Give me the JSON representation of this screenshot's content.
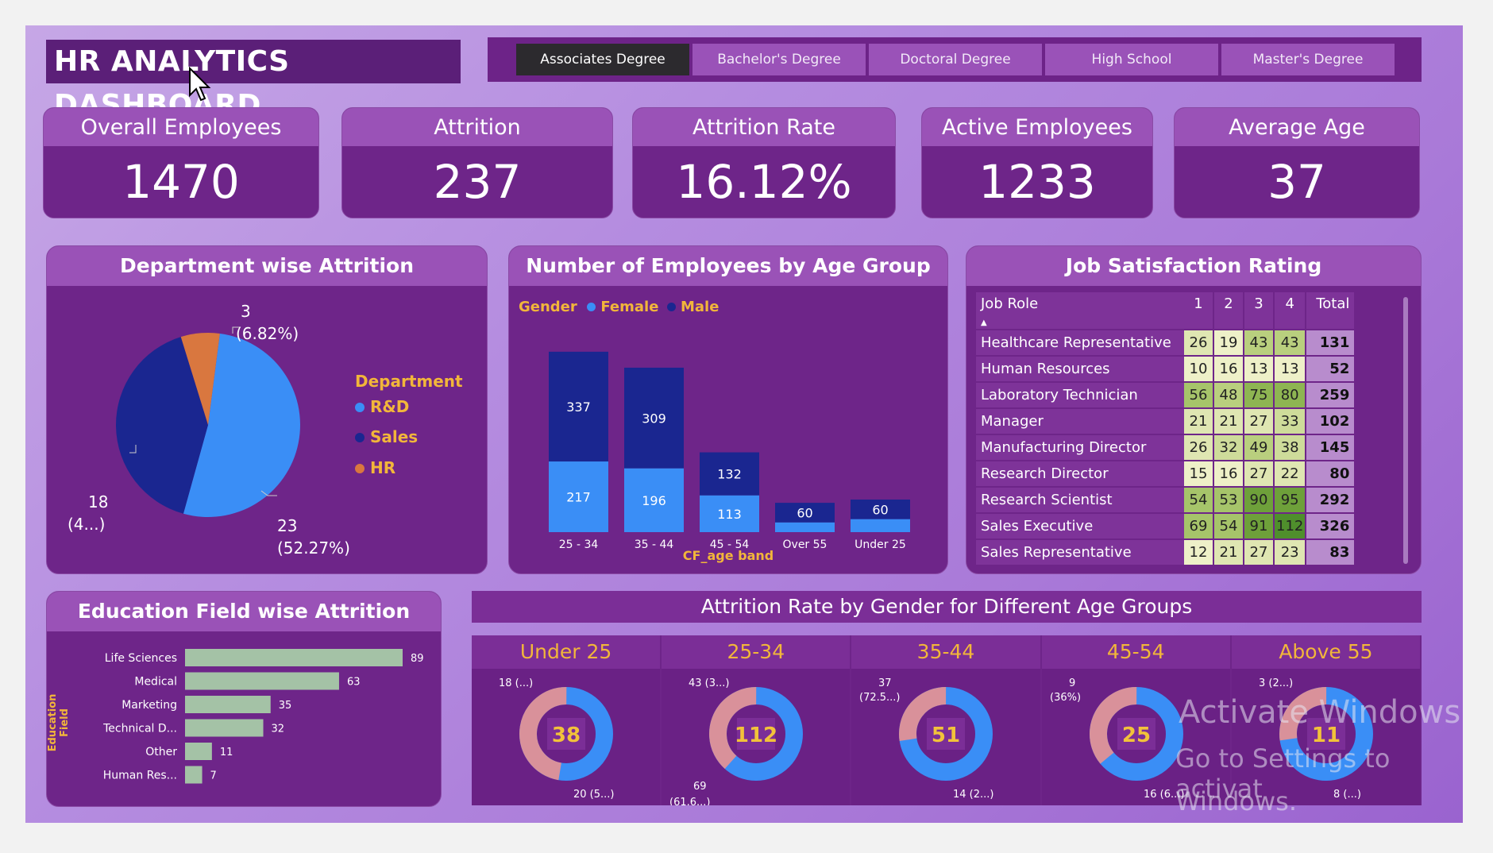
{
  "title": "HR ANALYTICS DASHBOARD",
  "slicer": {
    "options": [
      "Associates Degree",
      "Bachelor's Degree",
      "Doctoral Degree",
      "High School",
      "Master's Degree"
    ],
    "selected": "Associates Degree"
  },
  "kpis": [
    {
      "label": "Overall Employees",
      "value": "1470"
    },
    {
      "label": "Attrition",
      "value": "237"
    },
    {
      "label": "Attrition Rate",
      "value": "16.12%"
    },
    {
      "label": "Active Employees",
      "value": "1233"
    },
    {
      "label": "Average Age",
      "value": "37"
    }
  ],
  "dept": {
    "title": "Department wise Attrition",
    "legend_title": "Department",
    "labels": {
      "hr": {
        "v": "3",
        "p": "(6.82%)"
      },
      "sales": {
        "v": "18",
        "p": "(4...)"
      },
      "rd": {
        "v": "23",
        "p": "(52.27%)"
      }
    }
  },
  "age_group": {
    "title": "Number of Employees by Age Group",
    "legend_title": "Gender",
    "xlabel": "CF_age band"
  },
  "job_sat": {
    "title": "Job Satisfaction Rating",
    "headers": [
      "Job Role",
      "1",
      "2",
      "3",
      "4",
      "Total"
    ],
    "rows": [
      [
        "Healthcare Representative",
        "26",
        "19",
        "43",
        "43",
        "131"
      ],
      [
        "Human Resources",
        "10",
        "16",
        "13",
        "13",
        "52"
      ],
      [
        "Laboratory Technician",
        "56",
        "48",
        "75",
        "80",
        "259"
      ],
      [
        "Manager",
        "21",
        "21",
        "27",
        "33",
        "102"
      ],
      [
        "Manufacturing Director",
        "26",
        "32",
        "49",
        "38",
        "145"
      ],
      [
        "Research Director",
        "15",
        "16",
        "27",
        "22",
        "80"
      ],
      [
        "Research Scientist",
        "54",
        "53",
        "90",
        "95",
        "292"
      ],
      [
        "Sales Executive",
        "69",
        "54",
        "91",
        "112",
        "326"
      ],
      [
        "Sales Representative",
        "12",
        "21",
        "27",
        "23",
        "83"
      ]
    ]
  },
  "edu": {
    "title": "Education Field wise Attrition",
    "ylabel": "Education Field"
  },
  "gender_age": {
    "title": "Attrition Rate by Gender for Different Age Groups",
    "groups": [
      {
        "name": "Under 25",
        "center": "38",
        "top": "18 (...)",
        "top2": "",
        "bottom": "20 (5...)",
        "bottom2": ""
      },
      {
        "name": "25-34",
        "center": "112",
        "top": "43 (3...)",
        "top2": "",
        "bottom": "69",
        "bottom2": "(61.6...)"
      },
      {
        "name": "35-44",
        "center": "51",
        "top": "37",
        "top2": "(72.5...)",
        "bottom": "14 (2...)",
        "bottom2": ""
      },
      {
        "name": "45-54",
        "center": "25",
        "top": "9",
        "top2": "(36%)",
        "bottom": "16 (6...)",
        "bottom2": ""
      },
      {
        "name": "Above 55",
        "center": "11",
        "top": "3 (2...)",
        "top2": "",
        "bottom": "8 (...)",
        "bottom2": ""
      }
    ]
  },
  "watermark": {
    "line1": "Activate Windows",
    "line2": "Go to Settings to activat",
    "line3": "Windows."
  },
  "colors": {
    "female": "#3a8ef6",
    "male": "#1a2690",
    "hr": "#d9773f",
    "bar": "#a4c2a6",
    "donut_female": "#3a8ef6",
    "donut_male": "#d9919a"
  },
  "chart_data": [
    {
      "type": "pie",
      "title": "Department wise Attrition",
      "categories": [
        "R&D",
        "Sales",
        "HR"
      ],
      "values": [
        23,
        18,
        3
      ],
      "legend": "right"
    },
    {
      "type": "bar",
      "title": "Number of Employees by Age Group",
      "categories": [
        "25 - 34",
        "35 - 44",
        "45 - 54",
        "Over 55",
        "Under 25"
      ],
      "series": [
        {
          "name": "Female",
          "values": [
            217,
            196,
            113,
            30,
            40
          ]
        },
        {
          "name": "Male",
          "values": [
            337,
            309,
            132,
            60,
            60
          ]
        }
      ],
      "xlabel": "CF_age band",
      "stacked": true,
      "legend": "top-left"
    },
    {
      "type": "bar",
      "title": "Education Field wise Attrition",
      "categories": [
        "Life Sciences",
        "Medical",
        "Marketing",
        "Technical D...",
        "Other",
        "Human Res..."
      ],
      "values": [
        89,
        63,
        35,
        32,
        11,
        7
      ],
      "ylabel": "Education Field",
      "orientation": "horizontal"
    },
    {
      "type": "pie",
      "title": "Attrition Rate by Gender for Different Age Groups",
      "categories": [
        "Under 25",
        "25-34",
        "35-44",
        "45-54",
        "Above 55"
      ],
      "series": [
        {
          "name": "Female",
          "values": [
            20,
            69,
            37,
            16,
            8
          ]
        },
        {
          "name": "Male",
          "values": [
            18,
            43,
            14,
            9,
            3
          ]
        }
      ]
    }
  ]
}
